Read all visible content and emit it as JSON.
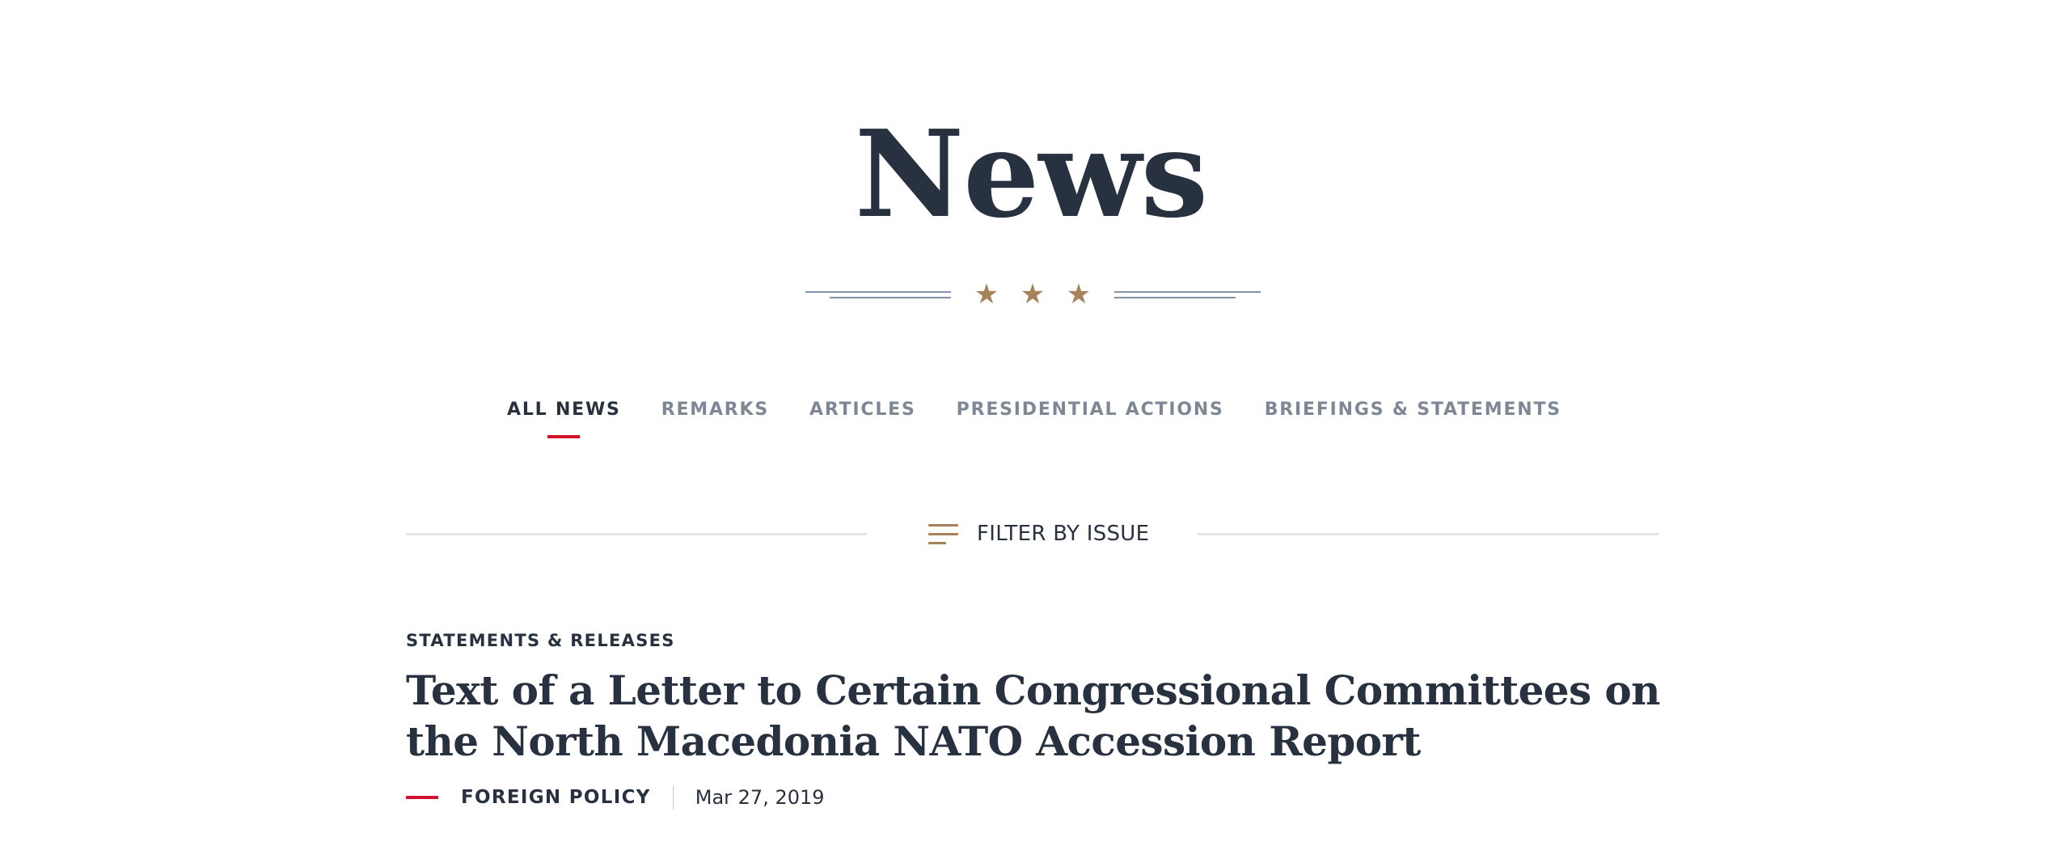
{
  "header": {
    "title": "News",
    "ornament_stars": [
      "★",
      "★",
      "★"
    ]
  },
  "tabs": [
    {
      "label": "All News",
      "active": true
    },
    {
      "label": "Remarks",
      "active": false
    },
    {
      "label": "Articles",
      "active": false
    },
    {
      "label": "Presidential Actions",
      "active": false
    },
    {
      "label": "Briefings & Statements",
      "active": false
    }
  ],
  "filter": {
    "label": "FILTER BY ISSUE",
    "icon": "filter-lines-icon"
  },
  "articles": [
    {
      "category": "Statements & Releases",
      "title": "Text of a Letter to Certain Congressional Committees on the North Macedonia NATO Accession Report",
      "issue": "Foreign Policy",
      "date": "Mar 27, 2019"
    }
  ],
  "colors": {
    "text": "#28313f",
    "muted": "#7d8796",
    "accent_red": "#d2112c",
    "gold": "#a68358",
    "ornament_blue": "#8493ad",
    "rule": "#e6e6e6"
  }
}
